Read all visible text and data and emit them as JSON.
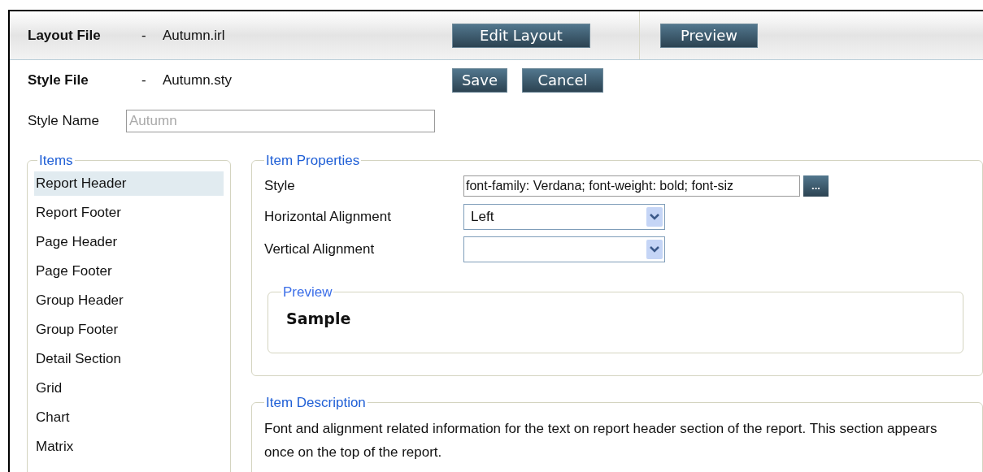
{
  "header": {
    "layout_file": {
      "label": "Layout File",
      "separator": "-",
      "value": "Autumn.irl"
    },
    "buttons": [
      "Edit Layout",
      "Preview"
    ]
  },
  "style_file": {
    "label": "Style File",
    "separator": "-",
    "value": "Autumn.sty"
  },
  "style_buttons": [
    "Save",
    "Cancel"
  ],
  "style_name": {
    "label": "Style Name",
    "placeholder": "Autumn"
  },
  "items": {
    "title": "Items",
    "list": [
      {
        "label": "Report Header",
        "selected": true
      },
      {
        "label": "Report Footer",
        "selected": false
      },
      {
        "label": "Page Header",
        "selected": false
      },
      {
        "label": "Page Footer",
        "selected": false
      },
      {
        "label": "Group Header",
        "selected": false
      },
      {
        "label": "Group Footer",
        "selected": false
      },
      {
        "label": "Detail Section",
        "selected": false
      },
      {
        "label": "Grid",
        "selected": false
      },
      {
        "label": "Chart",
        "selected": false
      },
      {
        "label": "Matrix",
        "selected": false
      }
    ]
  },
  "item_properties": {
    "title": "Item Properties",
    "style": {
      "label": "Style",
      "value": "font-family: Verdana; font-weight: bold; font-siz",
      "button": "..."
    },
    "horizontal_alignment": {
      "label": "Horizontal Alignment",
      "value": "Left"
    },
    "vertical_alignment": {
      "label": "Vertical Alignment"
    },
    "preview": {
      "title": "Preview",
      "sample": "Sample"
    }
  },
  "item_description": {
    "title": "Item Description",
    "text": "Font and alignment related information for the text on report header section of the report. This section appears once on the top of the report."
  }
}
